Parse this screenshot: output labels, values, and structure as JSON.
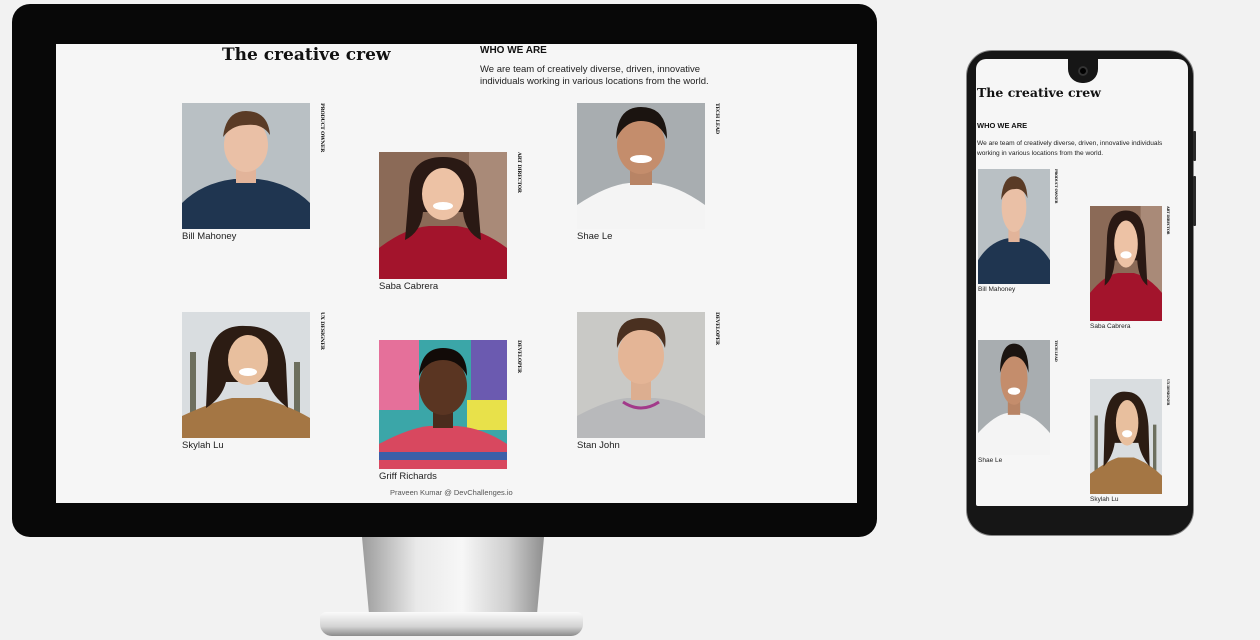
{
  "page": {
    "title": "The creative crew",
    "who_heading": "WHO WE ARE",
    "who_text": "We are team of creatively diverse, driven, innovative individuals working in various locations from the world.",
    "footer": "Praveen Kumar @ DevChallenges.io"
  },
  "members": [
    {
      "name": "Bill Mahoney",
      "role": "PRODUCT OWNER"
    },
    {
      "name": "Saba Cabrera",
      "role": "ART DIRECTOR"
    },
    {
      "name": "Shae Le",
      "role": "TECH LEAD"
    },
    {
      "name": "Skylah Lu",
      "role": "UX DESIGNER"
    },
    {
      "name": "Griff Richards",
      "role": "DEVELOPER"
    },
    {
      "name": "Stan John",
      "role": "DEVELOPER"
    }
  ],
  "colors": {
    "page_bg": "#f6f6f6",
    "device_frame": "#080808",
    "text": "#222222"
  }
}
